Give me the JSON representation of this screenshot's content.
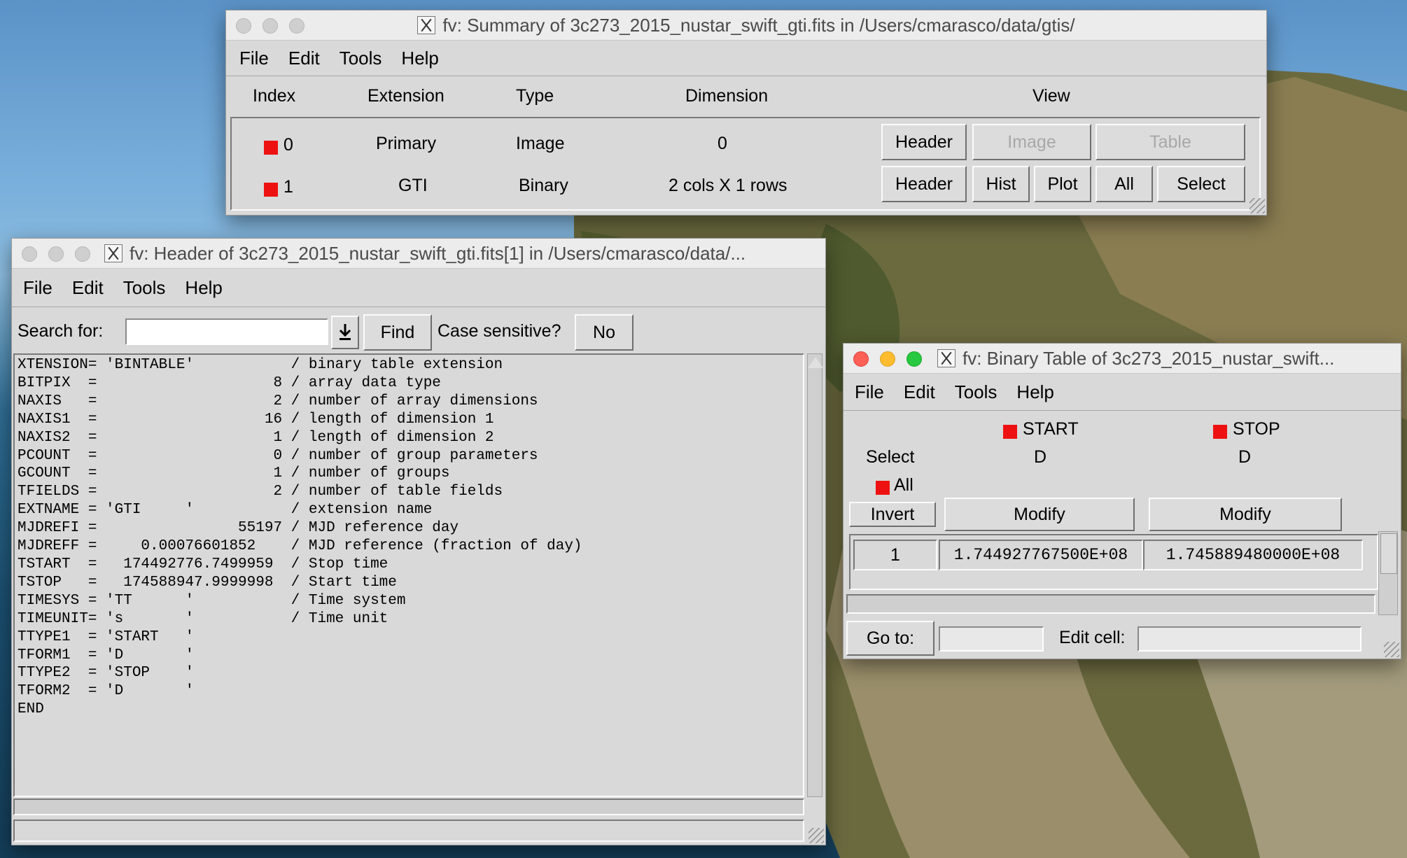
{
  "summary_window": {
    "title": "fv: Summary of 3c273_2015_nustar_swift_gti.fits in /Users/cmarasco/data/gtis/",
    "menu": [
      "File",
      "Edit",
      "Tools",
      "Help"
    ],
    "columns": [
      "Index",
      "Extension",
      "Type",
      "Dimension",
      "View"
    ],
    "rows": [
      {
        "index": "0",
        "extension": "Primary",
        "type": "Image",
        "dimension": "0"
      },
      {
        "index": "1",
        "extension": "GTI",
        "type": "Binary",
        "dimension": "2 cols X 1 rows"
      }
    ],
    "row0_buttons": {
      "header": "Header",
      "image": "Image",
      "table": "Table"
    },
    "row1_buttons": {
      "header": "Header",
      "hist": "Hist",
      "plot": "Plot",
      "all": "All",
      "select": "Select"
    }
  },
  "header_window": {
    "title": "fv: Header of 3c273_2015_nustar_swift_gti.fits[1] in /Users/cmarasco/data/...",
    "menu": [
      "File",
      "Edit",
      "Tools",
      "Help"
    ],
    "search_label": "Search for:",
    "search_value": "",
    "find_label": "Find",
    "case_label": "Case sensitive?",
    "case_value": "No",
    "lines": [
      "XTENSION= 'BINTABLE'           / binary table extension",
      "BITPIX  =                    8 / array data type",
      "NAXIS   =                    2 / number of array dimensions",
      "NAXIS1  =                   16 / length of dimension 1",
      "NAXIS2  =                    1 / length of dimension 2",
      "PCOUNT  =                    0 / number of group parameters",
      "GCOUNT  =                    1 / number of groups",
      "TFIELDS =                    2 / number of table fields",
      "EXTNAME = 'GTI     '           / extension name",
      "MJDREFI =                55197 / MJD reference day",
      "MJDREFF =     0.00076601852    / MJD reference (fraction of day)",
      "TSTART  =   174492776.7499959  / Stop time",
      "TSTOP   =   174588947.9999998  / Start time",
      "TIMESYS = 'TT      '           / Time system",
      "TIMEUNIT= 's       '           / Time unit",
      "TTYPE1  = 'START   '",
      "TFORM1  = 'D       '",
      "TTYPE2  = 'STOP    '",
      "TFORM2  = 'D       '",
      "END"
    ]
  },
  "table_window": {
    "title": "fv: Binary Table of 3c273_2015_nustar_swift...",
    "menu": [
      "File",
      "Edit",
      "Tools",
      "Help"
    ],
    "select_label": "Select",
    "all_label": "All",
    "invert_label": "Invert",
    "columns": [
      {
        "name": "START",
        "format": "D",
        "modify": "Modify"
      },
      {
        "name": "STOP",
        "format": "D",
        "modify": "Modify"
      }
    ],
    "row": {
      "index": "1",
      "start": "1.744927767500E+08",
      "stop": "1.745889480000E+08"
    },
    "goto_label": "Go to:",
    "goto_value": "",
    "editcell_label": "Edit cell:",
    "editcell_value": ""
  },
  "colors": {
    "selected_square": "#ee1111"
  }
}
